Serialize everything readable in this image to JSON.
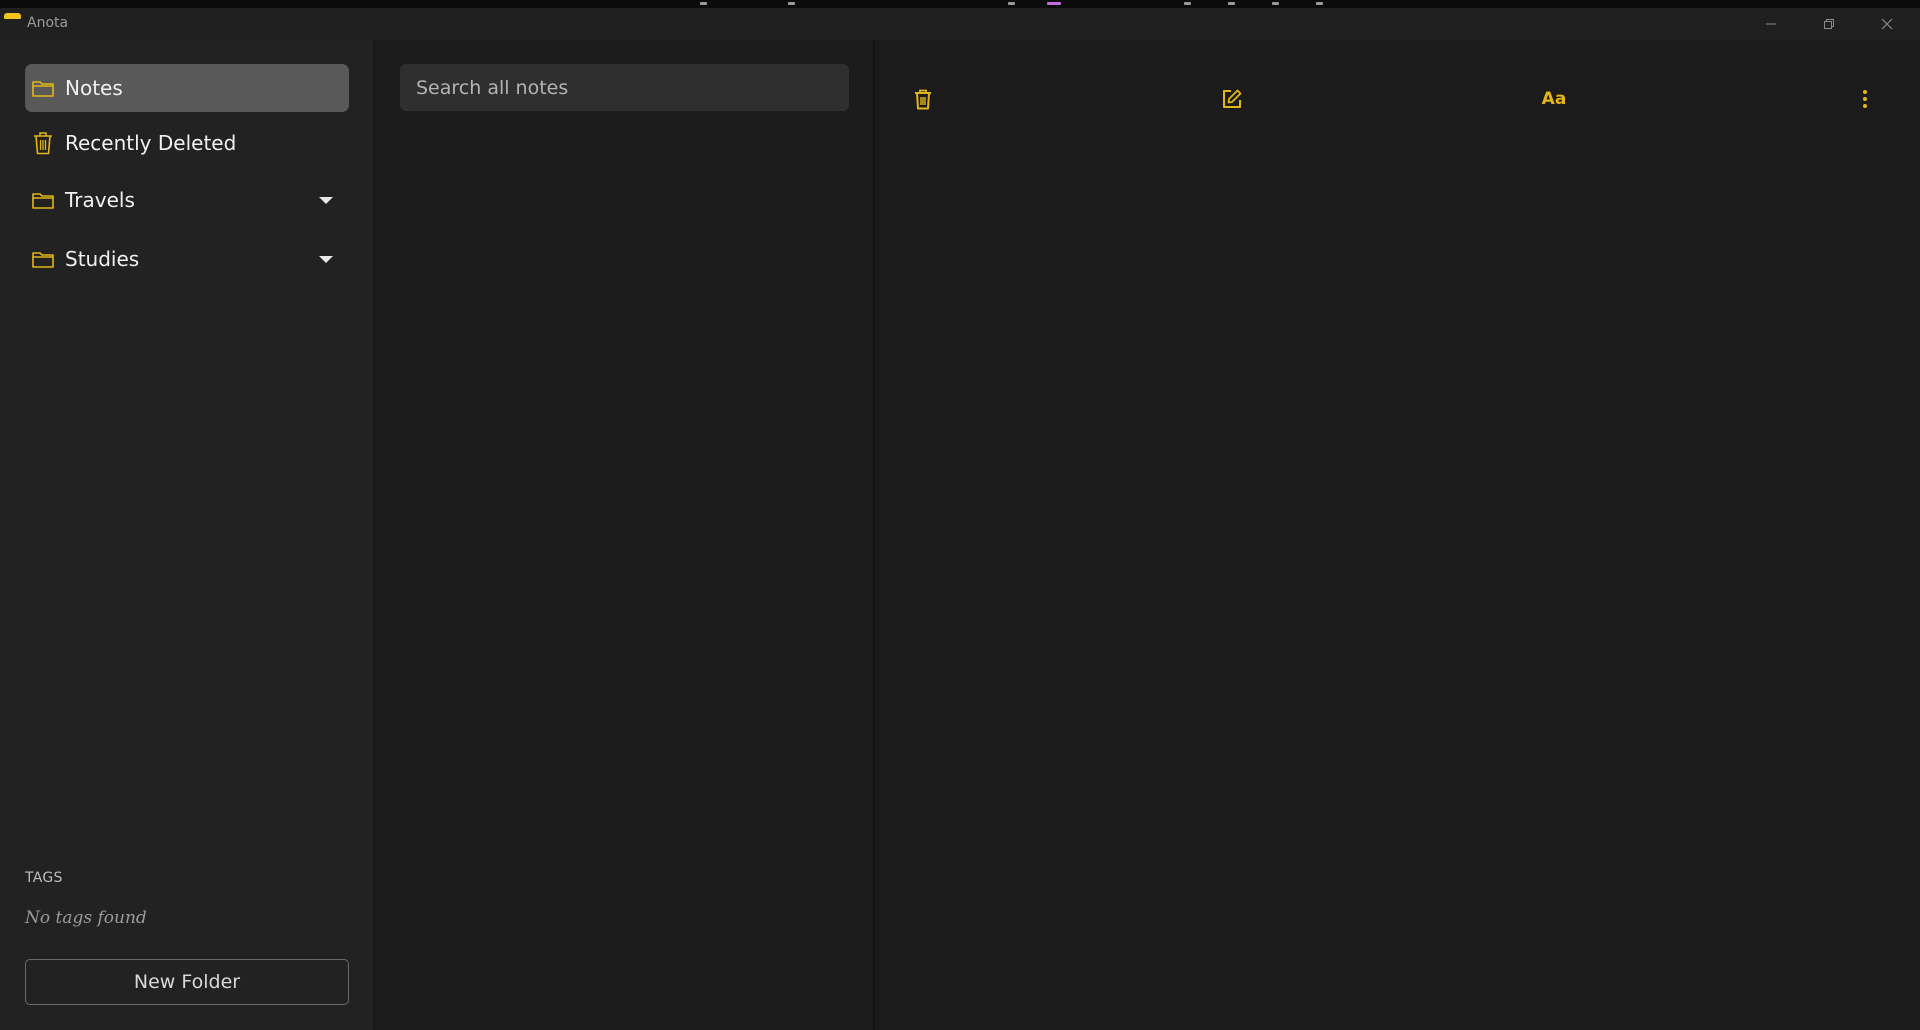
{
  "window": {
    "title": "Anota",
    "controls": {
      "minimize": "minimize-icon",
      "maximize": "restore-icon",
      "close": "close-icon"
    }
  },
  "sidebar": {
    "items": [
      {
        "label": "Notes",
        "icon": "folder-icon",
        "active": true,
        "expandable": false
      },
      {
        "label": "Recently Deleted",
        "icon": "trash-icon",
        "active": false,
        "expandable": false
      },
      {
        "label": "Travels",
        "icon": "folder-icon",
        "active": false,
        "expandable": true
      },
      {
        "label": "Studies",
        "icon": "folder-icon",
        "active": false,
        "expandable": true
      }
    ],
    "tags_heading": "TAGS",
    "tags_empty": "No tags found",
    "new_folder_label": "New Folder"
  },
  "list": {
    "search_placeholder": "Search all notes",
    "search_value": ""
  },
  "editor": {
    "toolbar": {
      "format_label": "Aa",
      "icons": [
        "trash-icon",
        "edit-icon",
        "format-icon",
        "more-vert-icon"
      ]
    }
  },
  "colors": {
    "accent": "#e2b51a",
    "active_item_bg": "#595959",
    "sidebar_bg": "#222222",
    "list_bg": "#1c1c1c",
    "editor_bg": "#1b1b1b"
  }
}
